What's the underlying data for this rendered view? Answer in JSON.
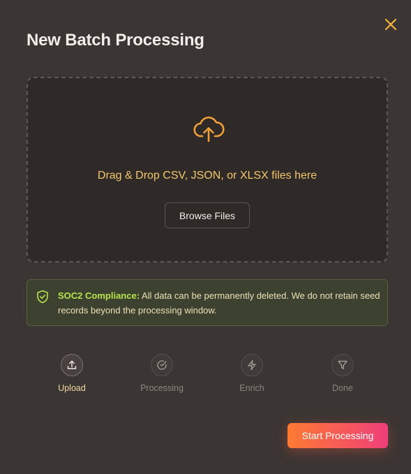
{
  "modal": {
    "title": "New Batch Processing"
  },
  "dropzone": {
    "text": "Drag & Drop CSV, JSON, or XLSX files here",
    "browse_label": "Browse Files"
  },
  "compliance": {
    "label": "SOC2 Compliance:",
    "message": "All data can be permanently deleted. We do not retain seed records beyond the processing window."
  },
  "steps": [
    {
      "label": "Upload",
      "icon": "upload-icon",
      "active": true
    },
    {
      "label": "Processing",
      "icon": "check-circle-icon",
      "active": false
    },
    {
      "label": "Enrich",
      "icon": "lightning-icon",
      "active": false
    },
    {
      "label": "Done",
      "icon": "filter-icon",
      "active": false
    }
  ],
  "actions": {
    "start_label": "Start Processing"
  },
  "colors": {
    "accent": "#f0a038",
    "background": "#3b3533",
    "success": "#b7e34e"
  }
}
